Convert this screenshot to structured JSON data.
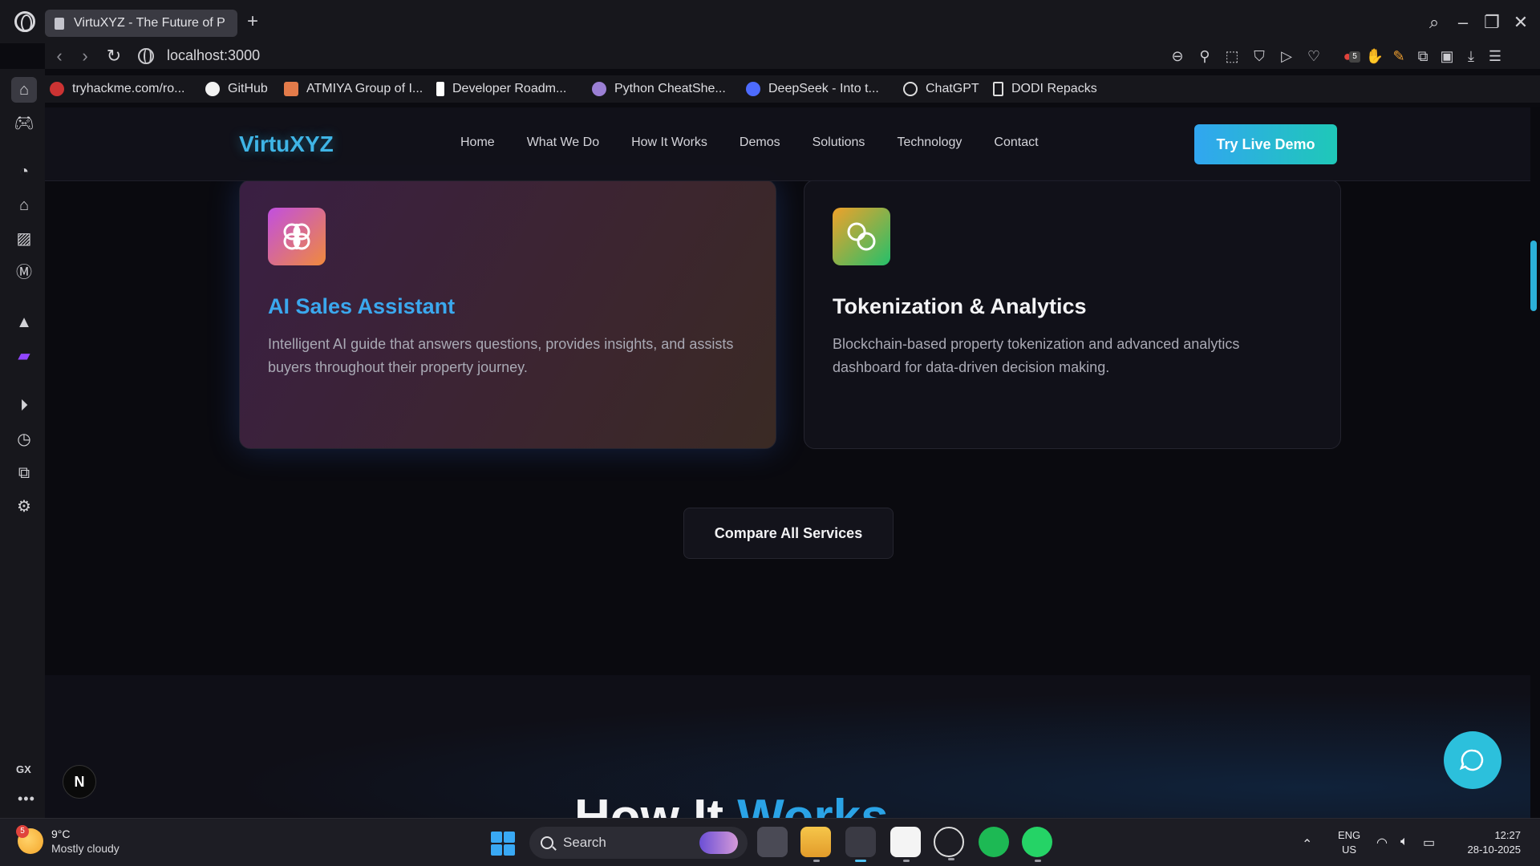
{
  "browser": {
    "tab_title": "VirtuXYZ - The Future of P",
    "url": "localhost:3000",
    "extension_badge_count": "5",
    "bookmarks": [
      {
        "label": "tryhackme.com/ro...",
        "icon": "tryhackme-icon"
      },
      {
        "label": "GitHub",
        "icon": "github-icon"
      },
      {
        "label": "ATMIYA Group of I...",
        "icon": "atmiya-icon"
      },
      {
        "label": "Developer Roadm...",
        "icon": "roadmap-icon"
      },
      {
        "label": "Python CheatShe...",
        "icon": "python-icon"
      },
      {
        "label": "DeepSeek - Into t...",
        "icon": "deepseek-icon"
      },
      {
        "label": "ChatGPT",
        "icon": "chatgpt-icon"
      },
      {
        "label": "DODI Repacks",
        "icon": "page-icon"
      }
    ],
    "sidebar_label": "GX"
  },
  "site": {
    "logo": "VirtuXYZ",
    "nav": [
      "Home",
      "What We Do",
      "How It Works",
      "Demos",
      "Solutions",
      "Technology",
      "Contact"
    ],
    "cta": "Try Live Demo",
    "cards": [
      {
        "title": "AI Sales Assistant",
        "desc": "Intelligent AI guide that answers questions, provides insights, and assists buyers throughout their property journey.",
        "icon": "brain-icon"
      },
      {
        "title": "Tokenization & Analytics",
        "desc": "Blockchain-based property tokenization and advanced analytics dashboard for data-driven decision making.",
        "icon": "coins-icon"
      }
    ],
    "compare_button": "Compare All Services",
    "section_heading_part1": "How It ",
    "section_heading_part2": "Works",
    "nextjs_badge": "N"
  },
  "taskbar": {
    "weather_badge": "5",
    "temperature": "9°C",
    "condition": "Mostly cloudy",
    "search_label": "Search",
    "lang_line1": "ENG",
    "lang_line2": "US",
    "time": "12:27",
    "date": "28-10-2025"
  },
  "colors": {
    "accent_blue": "#3ba8ee",
    "cta_start": "#31a6f0",
    "cta_end": "#1fc8b8",
    "chat_fab": "#2cc0dc"
  }
}
